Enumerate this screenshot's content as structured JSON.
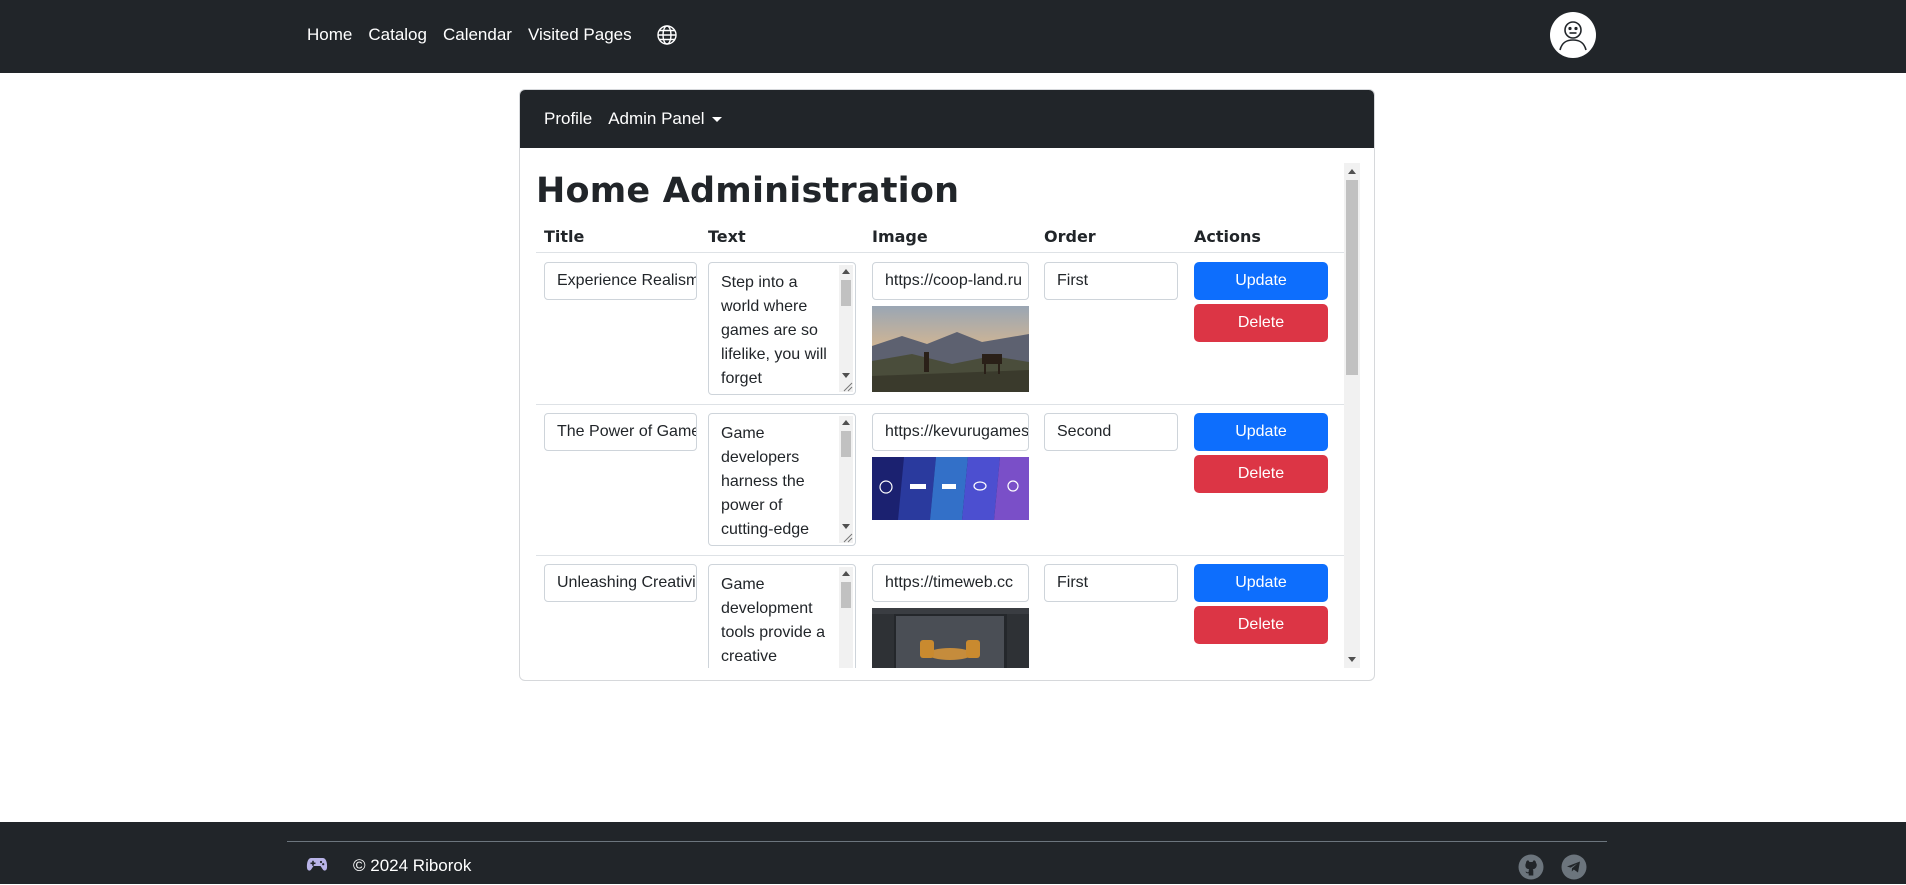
{
  "nav": {
    "links": [
      "Home",
      "Catalog",
      "Calendar",
      "Visited Pages"
    ],
    "language_icon": "globe-icon",
    "avatar_icon": "user-avatar-icon"
  },
  "admin_nav": {
    "profile": "Profile",
    "admin_panel": "Admin Panel"
  },
  "page": {
    "heading": "Home Administration",
    "columns": [
      "Title",
      "Text",
      "Image",
      "Order",
      "Actions"
    ]
  },
  "rows": [
    {
      "title": "Experience Realism",
      "text": "Step into a world where games are so lifelike, you will forget",
      "image_url": "https://coop-land.ru",
      "order": "First",
      "update": "Update",
      "delete": "Delete"
    },
    {
      "title": "The Power of Game",
      "text": "Game developers harness the power of cutting-edge",
      "image_url": "https://kevurugames",
      "order": "Second",
      "update": "Update",
      "delete": "Delete"
    },
    {
      "title": "Unleashing Creativity",
      "text": "Game development tools provide a creative",
      "image_url": "https://timeweb.cc",
      "order": "First",
      "update": "Update",
      "delete": "Delete"
    }
  ],
  "footer": {
    "copyright": "© 2024 Riborok",
    "icons": [
      "gamepad-icon",
      "github-icon",
      "telegram-icon"
    ]
  },
  "colors": {
    "dark": "#212529",
    "primary": "#0d6efd",
    "danger": "#dc3545"
  }
}
